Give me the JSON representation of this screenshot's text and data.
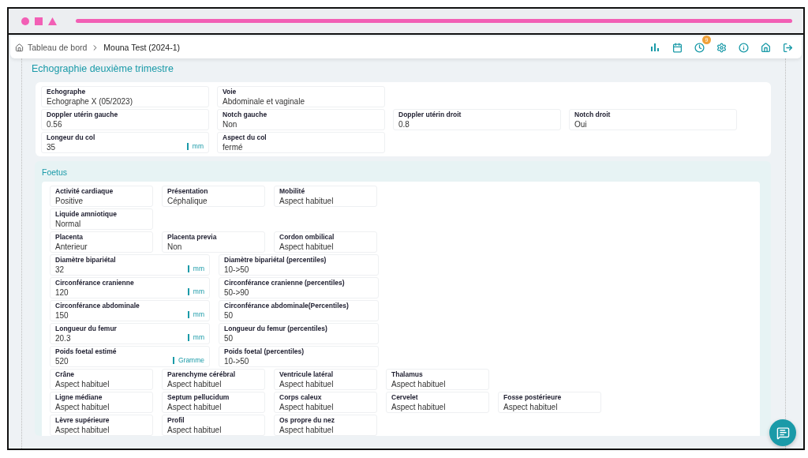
{
  "breadcrumbs": [
    {
      "label": "Tableau de bord",
      "kind": "home"
    },
    {
      "label": "Mouna Test (2024-1)",
      "kind": "current"
    }
  ],
  "toolbar": [
    {
      "kind": "stats"
    },
    {
      "kind": "calendar"
    },
    {
      "kind": "history",
      "badge": "9"
    },
    {
      "kind": "settings"
    },
    {
      "kind": "info"
    },
    {
      "kind": "home"
    },
    {
      "kind": "logout"
    }
  ],
  "section_title": "Echographie deuxième trimestre",
  "general": {
    "rows": [
      [
        {
          "label": "Echographe",
          "value": "Echographe X (05/2023)"
        },
        {
          "label": "Voie",
          "value": "Abdominale et vaginale"
        }
      ],
      [
        {
          "label": "Doppler utérin gauche",
          "value": "0.56"
        },
        {
          "label": "Notch gauche",
          "value": "Non"
        },
        {
          "label": "Doppler utérin droit",
          "value": "0.8"
        },
        {
          "label": "Notch droit",
          "value": "Oui"
        }
      ],
      [
        {
          "label": "Longeur du col",
          "value": "35",
          "unit": "mm"
        },
        {
          "label": "Aspect du col",
          "value": "fermé"
        }
      ]
    ]
  },
  "foetus": {
    "title": "Foetus",
    "rows": [
      [
        {
          "kind": "narrow",
          "label": "Activité cardiaque",
          "value": "Positive"
        },
        {
          "kind": "narrow",
          "label": "Présentation",
          "value": "Céphalique"
        },
        {
          "kind": "narrow",
          "label": "Mobilité",
          "value": "Aspect habituel"
        }
      ],
      [
        {
          "kind": "narrow",
          "label": "Liquide amniotique",
          "value": "Normal"
        }
      ],
      [
        {
          "kind": "narrow",
          "label": "Placenta",
          "value": "Anterieur"
        },
        {
          "kind": "narrow",
          "label": "Placenta previa",
          "value": "Non"
        },
        {
          "kind": "narrow",
          "label": "Cordon ombilical",
          "value": "Aspect habituel"
        }
      ],
      [
        {
          "kind": "wide",
          "label": "Diamètre bipariétal",
          "value": "32",
          "unit": "mm"
        },
        {
          "kind": "wide",
          "label": "Diamètre bipariétal (percentiles)",
          "value": "10->50"
        }
      ],
      [
        {
          "kind": "wide",
          "label": "Circonférance cranienne",
          "value": "120",
          "unit": "mm"
        },
        {
          "kind": "wide",
          "label": "Circonférance cranienne (percentiles)",
          "value": "50->90"
        }
      ],
      [
        {
          "kind": "wide",
          "label": "Circonférance abdominale",
          "value": "150",
          "unit": "mm"
        },
        {
          "kind": "wide",
          "label": "Circonférance abdominale(Percentiles)",
          "value": "50"
        }
      ],
      [
        {
          "kind": "wide",
          "label": "Longueur du femur",
          "value": "20.3",
          "unit": "mm"
        },
        {
          "kind": "wide",
          "label": "Longueur du femur (percentiles)",
          "value": "50"
        }
      ],
      [
        {
          "kind": "wide",
          "label": "Poids foetal estimé",
          "value": "520",
          "unit": "Gramme"
        },
        {
          "kind": "wide",
          "label": "Poids foetal (percentiles)",
          "value": "10->50"
        }
      ],
      [
        {
          "kind": "narrow",
          "label": "Crâne",
          "value": "Aspect habituel"
        },
        {
          "kind": "narrow",
          "label": "Parenchyme cérébral",
          "value": "Aspect habituel"
        },
        {
          "kind": "narrow",
          "label": "Ventricule latéral",
          "value": "Aspect habituel"
        },
        {
          "kind": "narrow",
          "label": "Thalamus",
          "value": "Aspect habituel"
        }
      ],
      [
        {
          "kind": "narrow",
          "label": "Ligne médiane",
          "value": "Aspect habituel"
        },
        {
          "kind": "narrow",
          "label": "Septum pellucidum",
          "value": "Aspect habituel"
        },
        {
          "kind": "narrow",
          "label": "Corps caleux",
          "value": "Aspect habituel"
        },
        {
          "kind": "narrow",
          "label": "Cervelet",
          "value": "Aspect habituel"
        },
        {
          "kind": "narrow",
          "label": "Fosse postérieure",
          "value": "Aspect habituel"
        }
      ],
      [
        {
          "kind": "narrow",
          "label": "Lèvre supérieure",
          "value": "Aspect habituel"
        },
        {
          "kind": "narrow",
          "label": "Profil",
          "value": "Aspect habituel"
        },
        {
          "kind": "narrow",
          "label": "Os propre du nez",
          "value": "Aspect habituel"
        }
      ]
    ]
  }
}
